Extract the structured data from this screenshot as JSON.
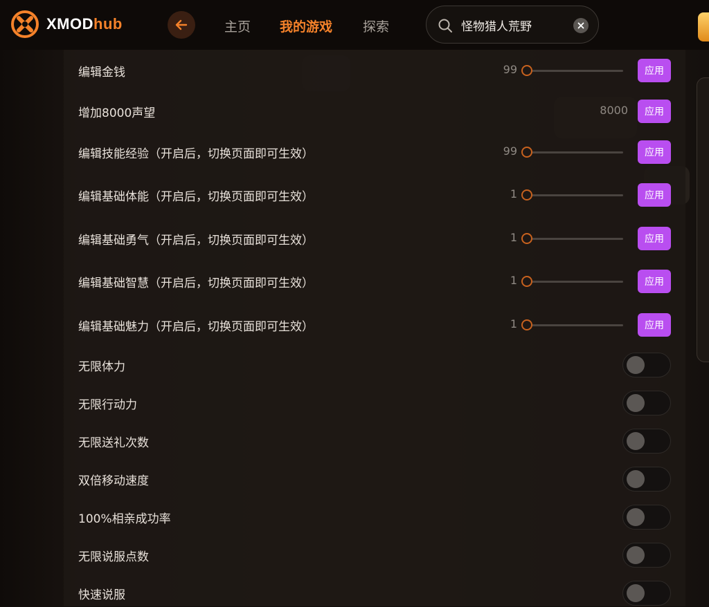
{
  "header": {
    "brand_main": "XMOD",
    "brand_accent": "hub",
    "nav": [
      "主页",
      "我的游戏",
      "探索"
    ],
    "active_nav": "我的游戏",
    "search_value": "怪物猎人荒野",
    "colors": {
      "accent": "#f5822a",
      "apply": "#b94ef0"
    }
  },
  "sliders": [
    {
      "label": "编辑金钱",
      "value": "99",
      "button": "应用"
    },
    {
      "label": "增加8000声望",
      "value": "8000",
      "button": "应用"
    },
    {
      "label": "编辑技能经验（开启后，切换页面即可生效）",
      "value": "99",
      "button": "应用"
    },
    {
      "label": "编辑基础体能（开启后，切换页面即可生效）",
      "value": "1",
      "button": "应用"
    },
    {
      "label": "编辑基础勇气（开启后，切换页面即可生效）",
      "value": "1",
      "button": "应用"
    },
    {
      "label": "编辑基础智慧（开启后，切换页面即可生效）",
      "value": "1",
      "button": "应用"
    },
    {
      "label": "编辑基础魅力（开启后，切换页面即可生效）",
      "value": "1",
      "button": "应用"
    }
  ],
  "toggles": [
    {
      "label": "无限体力",
      "on": false
    },
    {
      "label": "无限行动力",
      "on": false
    },
    {
      "label": "无限送礼次数",
      "on": false
    },
    {
      "label": "双倍移动速度",
      "on": false
    },
    {
      "label": "100%相亲成功率",
      "on": false
    },
    {
      "label": "无限说服点数",
      "on": false
    },
    {
      "label": "快速说服",
      "on": false
    }
  ]
}
